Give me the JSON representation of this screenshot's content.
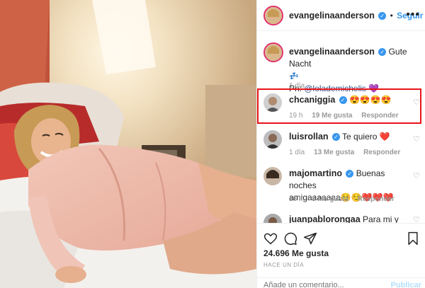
{
  "post": {
    "author": "evangelinaanderson",
    "follow_label": "Seguir",
    "more_label": "•••"
  },
  "caption": {
    "username": "evangelinaanderson",
    "text": "Gute Nacht",
    "credit_prefix": "Ph:",
    "credit_mention": "@lolademichelis",
    "time": "1 día"
  },
  "comments": [
    {
      "username": "chcaniggia",
      "text": "😍😍😍😍",
      "time": "19 h",
      "likes": "19 Me gusta",
      "reply": "Responder",
      "verified": true
    },
    {
      "username": "luisrollan",
      "text": "Te quiero ❤️",
      "time": "1 día",
      "likes": "13 Me gusta",
      "reply": "Responder",
      "verified": true
    },
    {
      "username": "majomartino",
      "text": "Buenas noches",
      "text2": "amigaaaaaaa☺️☺️❤️❤️❤️",
      "time": "16 h",
      "likes": "8 Me gusta",
      "reply": "Responder",
      "verified": true
    },
    {
      "username": "juanpablorongaa",
      "text": "Para mi y con",
      "verified": false
    }
  ],
  "footer": {
    "likes": "24.696 Me gusta",
    "ago": "HACE UN DÍA",
    "comment_placeholder": "Añade un comentario...",
    "publish_label": "Publicar"
  },
  "colors": {
    "accent": "#3897f0",
    "highlight": "#e8141a",
    "heart": "#ed4956"
  }
}
